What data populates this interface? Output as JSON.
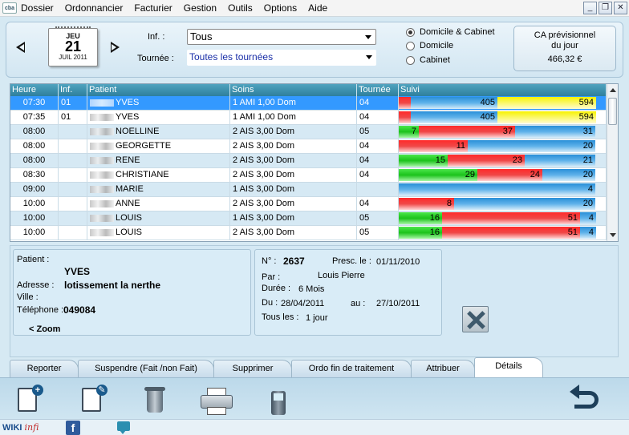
{
  "menu": [
    "Dossier",
    "Ordonnancier",
    "Facturier",
    "Gestion",
    "Outils",
    "Options",
    "Aide"
  ],
  "window_buttons": {
    "minimize": "_",
    "restore": "❐",
    "close": "✕"
  },
  "app_logo": "cba",
  "date": {
    "dow": "JEU",
    "day": "21",
    "month_year": "JUIL 2011"
  },
  "filters": {
    "inf_label": "Inf. :",
    "inf_value": "Tous",
    "tournee_label": "Tournée :",
    "tournee_value": "Toutes les tournées"
  },
  "location_options": [
    {
      "label": "Domicile & Cabinet",
      "selected": true
    },
    {
      "label": "Domicile",
      "selected": false
    },
    {
      "label": "Cabinet",
      "selected": false
    }
  ],
  "ca": {
    "title_line1": "CA prévisionnel",
    "title_line2": "du jour",
    "value": "466,32 €"
  },
  "grid": {
    "columns": [
      "Heure",
      "Inf.",
      "Patient",
      "Soins",
      "Tournée",
      "Suivi"
    ],
    "rows": [
      {
        "heure": "07:30",
        "inf": "01",
        "patient": "YVES",
        "soins": "1 AMI 1,00 Dom",
        "tournee": "04",
        "selected": true,
        "segments": [
          {
            "c": "red",
            "w": 6,
            "v": ""
          },
          {
            "c": "blue",
            "w": 44,
            "v": "405"
          },
          {
            "c": "yellow",
            "w": 50,
            "v": "594"
          }
        ]
      },
      {
        "heure": "07:35",
        "inf": "01",
        "patient": "YVES",
        "soins": "1 AMI 1,00 Dom",
        "tournee": "04",
        "selected": false,
        "segments": [
          {
            "c": "red",
            "w": 6,
            "v": ""
          },
          {
            "c": "blue",
            "w": 44,
            "v": "405"
          },
          {
            "c": "yellow",
            "w": 50,
            "v": "594"
          }
        ]
      },
      {
        "heure": "08:00",
        "inf": "",
        "patient": "NOELLINE",
        "soins": "2 AIS 3,00 Dom",
        "tournee": "05",
        "selected": false,
        "segments": [
          {
            "c": "green",
            "w": 10,
            "v": "7"
          },
          {
            "c": "red",
            "w": 49,
            "v": "37"
          },
          {
            "c": "blue",
            "w": 41,
            "v": "31"
          }
        ]
      },
      {
        "heure": "08:00",
        "inf": "",
        "patient": "GEORGETTE",
        "soins": "2 AIS 3,00 Dom",
        "tournee": "04",
        "selected": false,
        "segments": [
          {
            "c": "red",
            "w": 35,
            "v": "11"
          },
          {
            "c": "blue",
            "w": 65,
            "v": "20"
          }
        ]
      },
      {
        "heure": "08:00",
        "inf": "",
        "patient": "RENE",
        "soins": "2 AIS 3,00 Dom",
        "tournee": "04",
        "selected": false,
        "segments": [
          {
            "c": "green",
            "w": 25,
            "v": "15"
          },
          {
            "c": "red",
            "w": 39,
            "v": "23"
          },
          {
            "c": "blue",
            "w": 36,
            "v": "21"
          }
        ]
      },
      {
        "heure": "08:30",
        "inf": "",
        "patient": "CHRISTIANE",
        "soins": "2 AIS 3,00 Dom",
        "tournee": "04",
        "selected": false,
        "segments": [
          {
            "c": "green",
            "w": 40,
            "v": "29"
          },
          {
            "c": "red",
            "w": 33,
            "v": "24"
          },
          {
            "c": "blue",
            "w": 27,
            "v": "20"
          }
        ]
      },
      {
        "heure": "09:00",
        "inf": "",
        "patient": "MARIE",
        "soins": "1 AIS 3,00 Dom",
        "tournee": "",
        "selected": false,
        "segments": [
          {
            "c": "blue",
            "w": 100,
            "v": "4"
          }
        ]
      },
      {
        "heure": "10:00",
        "inf": "",
        "patient": "ANNE",
        "soins": "2 AIS 3,00 Dom",
        "tournee": "04",
        "selected": false,
        "segments": [
          {
            "c": "red",
            "w": 28,
            "v": "8"
          },
          {
            "c": "blue",
            "w": 72,
            "v": "20"
          }
        ]
      },
      {
        "heure": "10:00",
        "inf": "",
        "patient": "LOUIS",
        "soins": "1 AIS 3,00 Dom",
        "tournee": "05",
        "selected": false,
        "segments": [
          {
            "c": "green",
            "w": 22,
            "v": "16"
          },
          {
            "c": "red",
            "w": 70,
            "v": "51"
          },
          {
            "c": "blue",
            "w": 8,
            "v": "4"
          }
        ]
      },
      {
        "heure": "10:00",
        "inf": "",
        "patient": "LOUIS",
        "soins": "2 AIS 3,00 Dom",
        "tournee": "05",
        "selected": false,
        "segments": [
          {
            "c": "green",
            "w": 22,
            "v": "16"
          },
          {
            "c": "red",
            "w": 70,
            "v": "51"
          },
          {
            "c": "blue",
            "w": 8,
            "v": "4"
          }
        ]
      }
    ]
  },
  "patient_card": {
    "patient_label": "Patient :",
    "patient_name": "YVES",
    "adresse_label": "Adresse :",
    "adresse_value": "lotissement la nerthe",
    "ville_label": "Ville :",
    "telephone_label": "Téléphone :",
    "telephone_value": "049084",
    "zoom": "< Zoom"
  },
  "ordo_card": {
    "num_label": "N° :",
    "num_value": "2637",
    "presc_label": "Presc. le :",
    "presc_value": "01/11/2010",
    "par_label": "Par :",
    "par_value": "Louis Pierre",
    "duree_label": "Durée :",
    "duree_value": "6 Mois",
    "du_label": "Du :",
    "du_value": "28/04/2011",
    "au_label": "au :",
    "au_value": "27/10/2011",
    "tous_label": "Tous les :",
    "tous_value": "1 jour"
  },
  "tabs": [
    "Reporter",
    "Suspendre (Fait /non Fait)",
    "Supprimer",
    "Ordo fin de traitement",
    "Attribuer",
    "Détails"
  ],
  "active_tab": "Détails",
  "statusbar": {
    "wiki": "WIKI",
    "wiki_suffix": "infi",
    "facebook": "f"
  },
  "colors": {
    "green": "#1bc21b",
    "red": "#f04747",
    "blue": "#5fb2ea",
    "yellow": "#fbf86a",
    "selected": "#3399ff",
    "header": "#2e7f9c"
  }
}
